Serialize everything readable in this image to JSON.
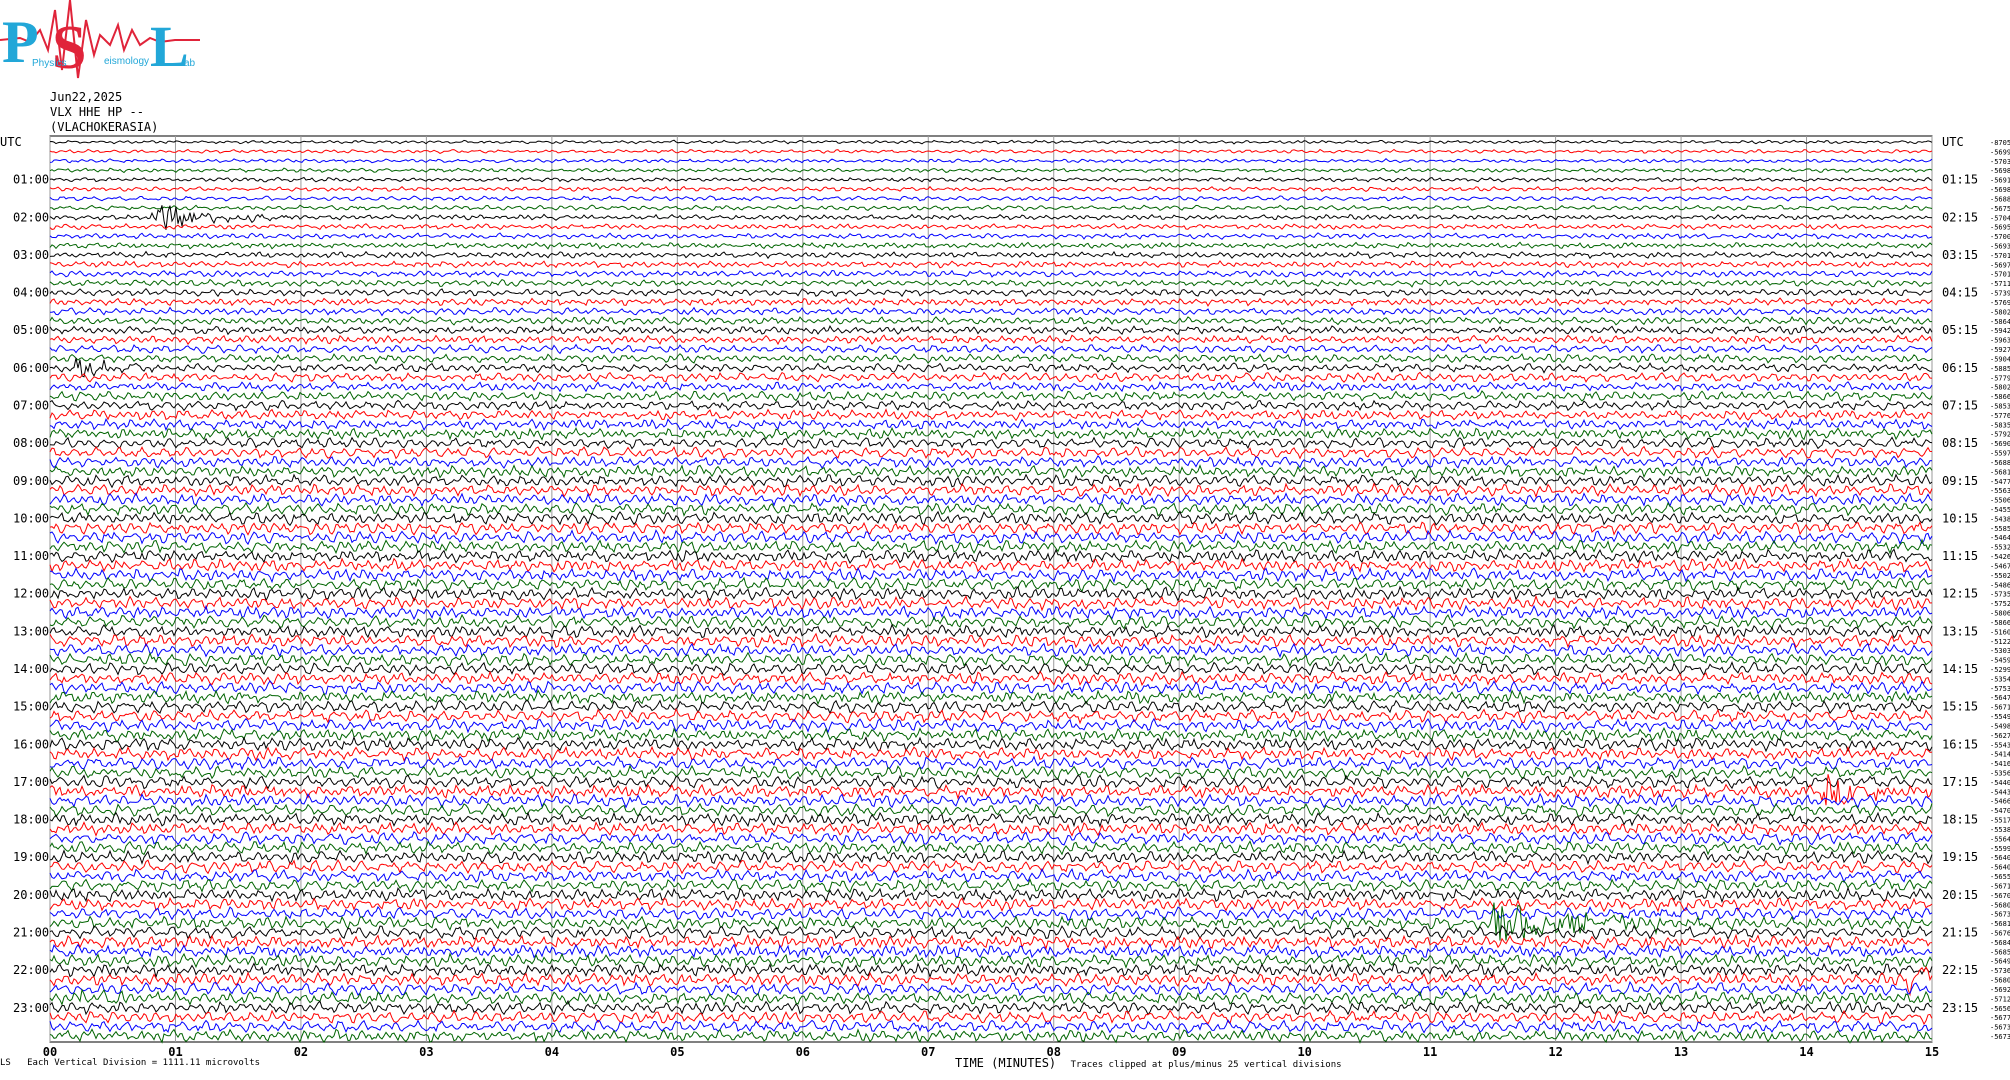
{
  "logo": {
    "letters": "PSL",
    "subtitle_a": "Physics",
    "subtitle_b": "eismology",
    "subtitle_c": "ab",
    "colors": {
      "blue": "#22a7d8",
      "red": "#e0243a"
    }
  },
  "header": {
    "date": "Jun22,2025",
    "station": "VLX HHE HP --",
    "location": "(VLACHOKERASIA)"
  },
  "axes": {
    "left_unit": "UTC",
    "right_unit": "UTC",
    "xlabel": "TIME (MINUTES)"
  },
  "footer": {
    "scale_note": "Each Vertical Division = 1111.11 microvolts",
    "clip_note": "Traces clipped at plus/minus 25 vertical divisions",
    "corner_mark": "LS"
  },
  "colors": {
    "cycle": [
      "#000000",
      "#ff0000",
      "#0000ff",
      "#006400"
    ],
    "grid": "#9a9a9a"
  },
  "chart_data": {
    "type": "line",
    "title": "",
    "xlabel": "TIME (MINUTES)",
    "xlim": [
      0,
      15
    ],
    "x_ticks": [
      "00",
      "01",
      "02",
      "03",
      "04",
      "05",
      "06",
      "07",
      "08",
      "09",
      "10",
      "11",
      "12",
      "13",
      "14",
      "15"
    ],
    "left_row_labels": [
      "UTC",
      "01:00",
      "02:00",
      "03:00",
      "04:00",
      "05:00",
      "06:00",
      "07:00",
      "08:00",
      "09:00",
      "10:00",
      "11:00",
      "12:00",
      "13:00",
      "14:00",
      "15:00",
      "16:00",
      "17:00",
      "18:00",
      "19:00",
      "20:00",
      "21:00",
      "22:00",
      "23:00"
    ],
    "right_row_labels": [
      "UTC",
      "01:15",
      "02:15",
      "03:15",
      "04:15",
      "05:15",
      "06:15",
      "07:15",
      "08:15",
      "09:15",
      "10:15",
      "11:15",
      "12:15",
      "13:15",
      "14:15",
      "15:15",
      "16:15",
      "17:15",
      "18:15",
      "19:15",
      "20:15",
      "21:15",
      "22:15",
      "23:15"
    ],
    "trace_offsets": [
      "-8705",
      "-5699",
      "-5703",
      "-5698",
      "-5691",
      "-5698",
      "-5688",
      "-5675",
      "-5704",
      "-5695",
      "-5700",
      "-5693",
      "-5701",
      "-5697",
      "-5701",
      "-5711",
      "-5739",
      "-5769",
      "-5802",
      "-5864",
      "-5942",
      "-5963",
      "-5927",
      "-5904",
      "-5885",
      "-5779",
      "-5802",
      "-5866",
      "-5853",
      "-5776",
      "-5835",
      "-5792",
      "-5690",
      "-5597",
      "-5688",
      "-5681",
      "-5477",
      "-5563",
      "-5506",
      "-5455",
      "-5438",
      "-5585",
      "-5464",
      "-5532",
      "-5426",
      "-5467",
      "-5502",
      "-5486",
      "-5735",
      "-5752",
      "-5806",
      "-5866",
      "-5160",
      "-5122",
      "-5303",
      "-5459",
      "-5299",
      "-5354",
      "-5753",
      "-5647",
      "-5671",
      "-5549",
      "-5498",
      "-5627",
      "-5543",
      "-5414",
      "-5416",
      "-5356",
      "-5440",
      "-5443",
      "-5466",
      "-5470",
      "-5517",
      "-5538",
      "-5564",
      "-5599",
      "-5640",
      "-5640",
      "-5655",
      "-5671",
      "-5670",
      "-5680",
      "-5673",
      "-5681",
      "-5676",
      "-5684",
      "-5685",
      "-5649",
      "-5736",
      "-5680",
      "-5692",
      "-5712",
      "-5656",
      "-5677",
      "-5673",
      "-5673"
    ],
    "rows": 96,
    "minutes_per_row": 15,
    "events": [
      {
        "row": 8,
        "minute": 0.85,
        "amplitude": 5,
        "width_min": 0.45
      },
      {
        "row": 24,
        "minute": 0.2,
        "amplitude": 4,
        "width_min": 0.35
      },
      {
        "row": 69,
        "minute": 14.15,
        "amplitude": 6,
        "width_min": 0.3
      },
      {
        "row": 83,
        "minute": 11.5,
        "amplitude": 7,
        "width_min": 0.8
      },
      {
        "row": 89,
        "minute": 14.8,
        "amplitude": 6,
        "width_min": 0.4
      },
      {
        "row": 91,
        "minute": 0.25,
        "amplitude": 3,
        "width_min": 0.4
      }
    ],
    "grid": true
  }
}
